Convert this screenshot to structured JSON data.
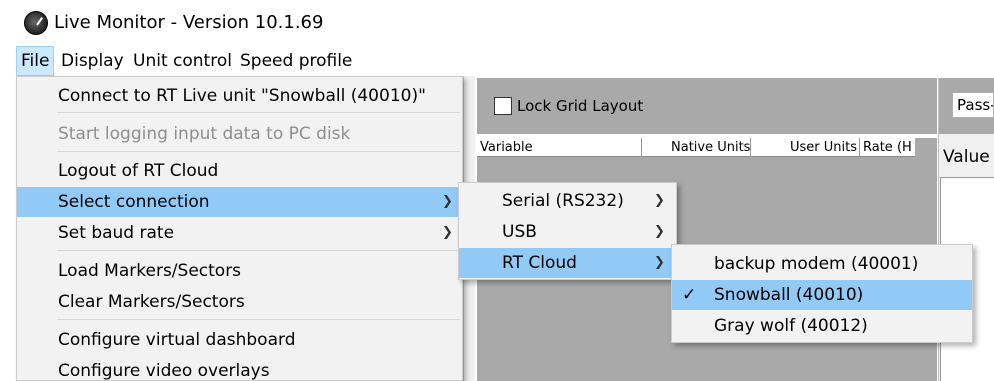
{
  "window": {
    "title": "Live Monitor - Version 10.1.69"
  },
  "menubar": {
    "items": [
      {
        "label": "File"
      },
      {
        "label": "Display"
      },
      {
        "label": "Unit control"
      },
      {
        "label": "Speed profile"
      }
    ]
  },
  "file_menu": {
    "items": [
      {
        "label": "Connect to RT Live unit \"Snowball (40010)\""
      },
      {
        "label": "Start logging input data to PC disk"
      },
      {
        "label": "Logout of RT Cloud"
      },
      {
        "label": "Select connection"
      },
      {
        "label": "Set baud rate"
      },
      {
        "label": "Load Markers/Sectors"
      },
      {
        "label": "Clear Markers/Sectors"
      },
      {
        "label": "Configure virtual dashboard"
      },
      {
        "label": "Configure video overlays"
      }
    ]
  },
  "connection_submenu": {
    "items": [
      {
        "label": "Serial (RS232)"
      },
      {
        "label": "USB"
      },
      {
        "label": "RT Cloud"
      }
    ]
  },
  "cloud_submenu": {
    "items": [
      {
        "label": "backup modem (40001)",
        "checked": false
      },
      {
        "label": "Snowball (40010)",
        "checked": true
      },
      {
        "label": "Gray wolf (40012)",
        "checked": false
      }
    ],
    "check_mark": "✓"
  },
  "grid_panel": {
    "lock_label": "Lock Grid Layout",
    "columns": [
      "Variable",
      "Native Units",
      "User Units",
      "Rate (H"
    ]
  },
  "right_panel": {
    "pass_text": "Pass-",
    "value_label": "Value"
  },
  "colors": {
    "highlight": "#91c9f7",
    "menu_bg": "#f2f2f2",
    "panel_gray": "#a9a9a9"
  }
}
